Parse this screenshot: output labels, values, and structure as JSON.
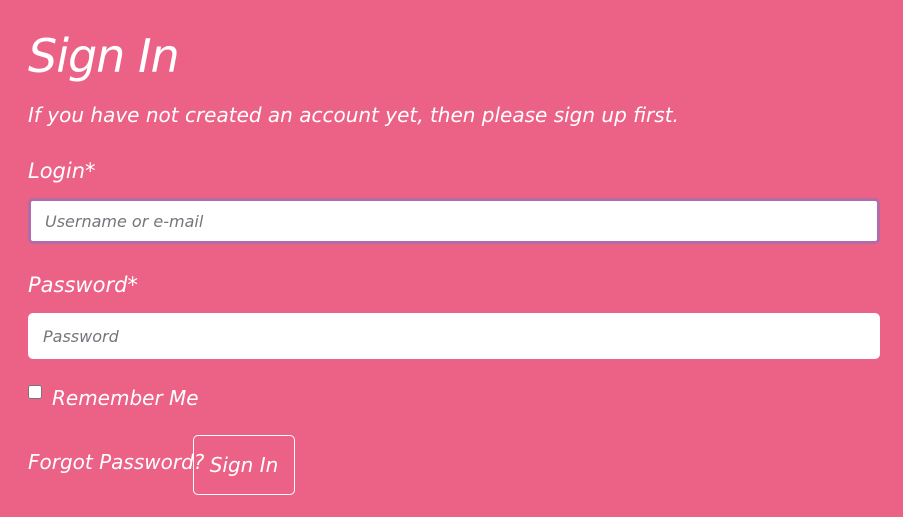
{
  "form": {
    "title": "Sign In",
    "subtitle": "If you have not created an account yet, then please sign up first.",
    "login": {
      "label": "Login*",
      "value": "",
      "placeholder": "Username or e-mail"
    },
    "password": {
      "label": "Password*",
      "value": "",
      "placeholder": "Password"
    },
    "remember_me": {
      "label": "Remember Me",
      "checked": false
    },
    "forgot_password": "Forgot Password?",
    "submit_label": "Sign In"
  },
  "colors": {
    "background": "#ec6286",
    "text": "#ffffff",
    "focus_border": "#b36ba7",
    "placeholder": "#75767c"
  }
}
